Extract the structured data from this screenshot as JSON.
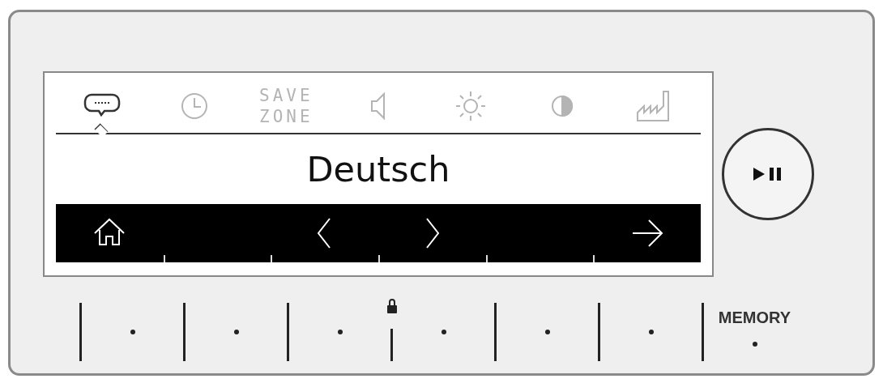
{
  "menu_tabs": [
    {
      "kind": "language",
      "selected": true
    },
    {
      "kind": "clock",
      "selected": false
    },
    {
      "kind": "text",
      "label": "SAVE ZONE",
      "selected": false
    },
    {
      "kind": "volume",
      "selected": false
    },
    {
      "kind": "brightness",
      "selected": false
    },
    {
      "kind": "contrast",
      "selected": false
    },
    {
      "kind": "factory",
      "selected": false
    }
  ],
  "value": "Deutsch",
  "nav_bar": [
    {
      "kind": "home"
    },
    {
      "kind": "previous"
    },
    {
      "kind": "next"
    },
    {
      "kind": "forward"
    }
  ],
  "play_pause": {
    "kind": "play-pause"
  },
  "keys": [
    {
      "kind": "key"
    },
    {
      "kind": "key"
    },
    {
      "kind": "key"
    },
    {
      "kind": "key",
      "locked": true
    },
    {
      "kind": "key"
    },
    {
      "kind": "key"
    },
    {
      "kind": "memory",
      "label": "MEMORY"
    }
  ]
}
